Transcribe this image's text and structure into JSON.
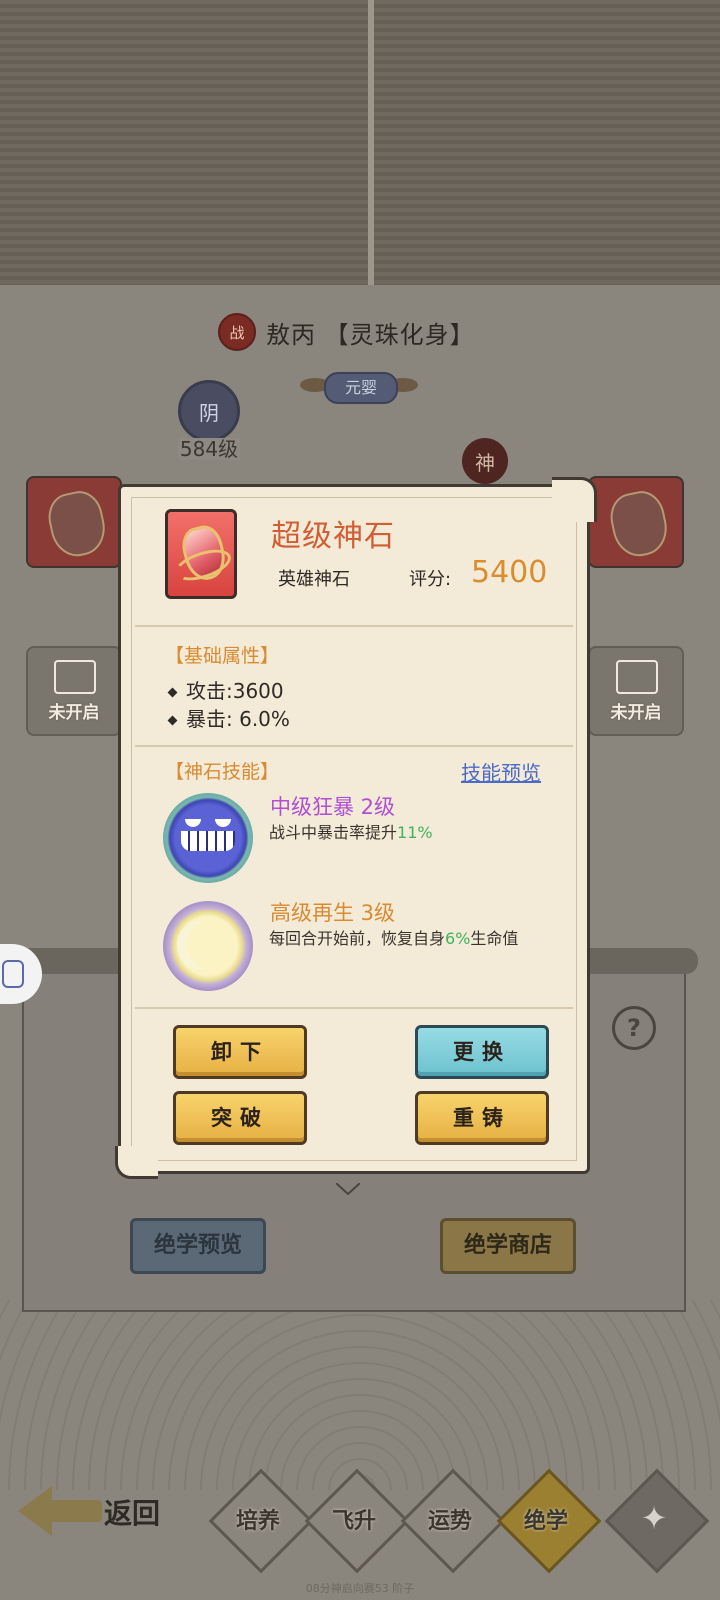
{
  "hero": {
    "badge": "战",
    "name": "敖丙 【灵珠化身】",
    "realm": "元婴"
  },
  "yin": {
    "char": "阴",
    "level": "584级"
  },
  "shen": "神",
  "locked_label": "未开启",
  "popup": {
    "item_name": "超级神石",
    "item_type": "英雄神石",
    "score_label": "评分:",
    "score_value": "5400",
    "base_title": "【基础属性】",
    "attrs": [
      {
        "label": "攻击:3600"
      },
      {
        "label": "暴击: 6.0%"
      }
    ],
    "skills_title": "【神石技能】",
    "skills_preview": "技能预览",
    "skills": [
      {
        "name": "中级狂暴 2级",
        "desc_pre": "战斗中暴击率提升",
        "desc_val": "11%",
        "desc_post": "",
        "color": "#b04fd1"
      },
      {
        "name": "高级再生 3级",
        "desc_pre": "每回合开始前，恢复自身",
        "desc_val": "6%",
        "desc_post": "生命值",
        "color": "#d78c32"
      }
    ],
    "buttons": {
      "unequip": "卸下",
      "replace": "更换",
      "breakthrough": "突破",
      "recast": "重铸"
    }
  },
  "bottom": {
    "preview": "绝学预览",
    "shop": "绝学商店",
    "help": "?"
  },
  "nav": {
    "back": "返回",
    "tabs": [
      "培养",
      "飞升",
      "运势",
      "绝学"
    ],
    "active_tab": "绝学"
  },
  "ticker": "08分神启向赛53 阶子"
}
